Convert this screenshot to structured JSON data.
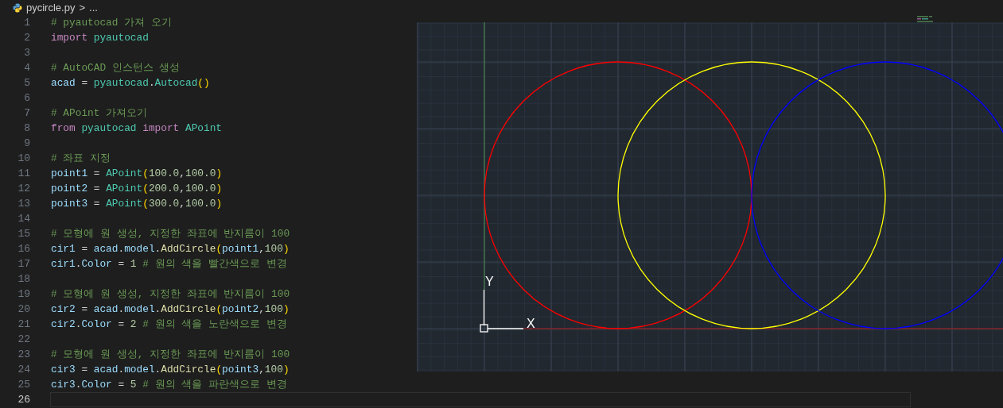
{
  "breadcrumb": {
    "file": "pycircle.py",
    "separator": ">",
    "rest": "..."
  },
  "lines": [
    {
      "number": "1",
      "current": false,
      "tokens": [
        {
          "t": "# pyautocad 가져 오기",
          "kind": "comment"
        }
      ]
    },
    {
      "number": "2",
      "current": false,
      "tokens": [
        {
          "t": "import ",
          "kind": "keyword"
        },
        {
          "t": "pyautocad",
          "kind": "class"
        }
      ]
    },
    {
      "number": "3",
      "current": false
    },
    {
      "number": "4",
      "current": false,
      "tokens": [
        {
          "t": "# AutoCAD 인스턴스 생성",
          "kind": "comment"
        }
      ]
    },
    {
      "number": "5",
      "current": false,
      "tokens": [
        {
          "t": "acad",
          "kind": "var"
        },
        {
          "t": " = ",
          "kind": "op"
        },
        {
          "t": "pyautocad",
          "kind": "class"
        },
        {
          "t": ".",
          "kind": "op"
        },
        {
          "t": "Autocad",
          "kind": "class"
        },
        {
          "t": "()",
          "kind": "paren"
        }
      ]
    },
    {
      "number": "6",
      "current": false
    },
    {
      "number": "7",
      "current": false,
      "tokens": [
        {
          "t": "# APoint 가져오기",
          "kind": "comment"
        }
      ]
    },
    {
      "number": "8",
      "current": false,
      "tokens": [
        {
          "t": "from ",
          "kind": "keyword"
        },
        {
          "t": "pyautocad ",
          "kind": "class"
        },
        {
          "t": "import ",
          "kind": "keyword"
        },
        {
          "t": "APoint",
          "kind": "class"
        }
      ]
    },
    {
      "number": "9",
      "current": false
    },
    {
      "number": "10",
      "current": false,
      "tokens": [
        {
          "t": "# 좌표 지정",
          "kind": "comment"
        }
      ]
    },
    {
      "number": "11",
      "current": false,
      "tokens": [
        {
          "t": "point1",
          "kind": "var"
        },
        {
          "t": " = ",
          "kind": "op"
        },
        {
          "t": "APoint",
          "kind": "class"
        },
        {
          "t": "(",
          "kind": "paren"
        },
        {
          "t": "100.0",
          "kind": "num"
        },
        {
          "t": ",",
          "kind": "op"
        },
        {
          "t": "100.0",
          "kind": "num"
        },
        {
          "t": ")",
          "kind": "paren"
        }
      ]
    },
    {
      "number": "12",
      "current": false,
      "tokens": [
        {
          "t": "point2",
          "kind": "var"
        },
        {
          "t": " = ",
          "kind": "op"
        },
        {
          "t": "APoint",
          "kind": "class"
        },
        {
          "t": "(",
          "kind": "paren"
        },
        {
          "t": "200.0",
          "kind": "num"
        },
        {
          "t": ",",
          "kind": "op"
        },
        {
          "t": "100.0",
          "kind": "num"
        },
        {
          "t": ")",
          "kind": "paren"
        }
      ]
    },
    {
      "number": "13",
      "current": false,
      "tokens": [
        {
          "t": "point3",
          "kind": "var"
        },
        {
          "t": " = ",
          "kind": "op"
        },
        {
          "t": "APoint",
          "kind": "class"
        },
        {
          "t": "(",
          "kind": "paren"
        },
        {
          "t": "300.0",
          "kind": "num"
        },
        {
          "t": ",",
          "kind": "op"
        },
        {
          "t": "100.0",
          "kind": "num"
        },
        {
          "t": ")",
          "kind": "paren"
        }
      ]
    },
    {
      "number": "14",
      "current": false
    },
    {
      "number": "15",
      "current": false,
      "tokens": [
        {
          "t": "# 모형에 원 생성, 지정한 좌표에 반지름이 100",
          "kind": "comment"
        }
      ]
    },
    {
      "number": "16",
      "current": false,
      "tokens": [
        {
          "t": "cir1",
          "kind": "var"
        },
        {
          "t": " = ",
          "kind": "op"
        },
        {
          "t": "acad",
          "kind": "var"
        },
        {
          "t": ".",
          "kind": "op"
        },
        {
          "t": "model",
          "kind": "var"
        },
        {
          "t": ".",
          "kind": "op"
        },
        {
          "t": "AddCircle",
          "kind": "func"
        },
        {
          "t": "(",
          "kind": "paren"
        },
        {
          "t": "point1",
          "kind": "var"
        },
        {
          "t": ",",
          "kind": "op"
        },
        {
          "t": "100",
          "kind": "num"
        },
        {
          "t": ")",
          "kind": "paren"
        }
      ]
    },
    {
      "number": "17",
      "current": false,
      "tokens": [
        {
          "t": "cir1",
          "kind": "var"
        },
        {
          "t": ".",
          "kind": "op"
        },
        {
          "t": "Color",
          "kind": "var"
        },
        {
          "t": " = ",
          "kind": "op"
        },
        {
          "t": "1",
          "kind": "num"
        },
        {
          "t": " # 원의 색을 빨간색으로 변경",
          "kind": "comment"
        }
      ]
    },
    {
      "number": "18",
      "current": false
    },
    {
      "number": "19",
      "current": false,
      "tokens": [
        {
          "t": "# 모형에 원 생성, 지정한 좌표에 반지름이 100",
          "kind": "comment"
        }
      ]
    },
    {
      "number": "20",
      "current": false,
      "tokens": [
        {
          "t": "cir2",
          "kind": "var"
        },
        {
          "t": " = ",
          "kind": "op"
        },
        {
          "t": "acad",
          "kind": "var"
        },
        {
          "t": ".",
          "kind": "op"
        },
        {
          "t": "model",
          "kind": "var"
        },
        {
          "t": ".",
          "kind": "op"
        },
        {
          "t": "AddCircle",
          "kind": "func"
        },
        {
          "t": "(",
          "kind": "paren"
        },
        {
          "t": "point2",
          "kind": "var"
        },
        {
          "t": ",",
          "kind": "op"
        },
        {
          "t": "100",
          "kind": "num"
        },
        {
          "t": ")",
          "kind": "paren"
        }
      ]
    },
    {
      "number": "21",
      "current": false,
      "tokens": [
        {
          "t": "cir2",
          "kind": "var"
        },
        {
          "t": ".",
          "kind": "op"
        },
        {
          "t": "Color",
          "kind": "var"
        },
        {
          "t": " = ",
          "kind": "op"
        },
        {
          "t": "2",
          "kind": "num"
        },
        {
          "t": " # 원의 색을 노란색으로 변경",
          "kind": "comment"
        }
      ]
    },
    {
      "number": "22",
      "current": false
    },
    {
      "number": "23",
      "current": false,
      "tokens": [
        {
          "t": "# 모형에 원 생성, 지정한 좌표에 반지름이 100",
          "kind": "comment"
        }
      ]
    },
    {
      "number": "24",
      "current": false,
      "tokens": [
        {
          "t": "cir3",
          "kind": "var"
        },
        {
          "t": " = ",
          "kind": "op"
        },
        {
          "t": "acad",
          "kind": "var"
        },
        {
          "t": ".",
          "kind": "op"
        },
        {
          "t": "model",
          "kind": "var"
        },
        {
          "t": ".",
          "kind": "op"
        },
        {
          "t": "AddCircle",
          "kind": "func"
        },
        {
          "t": "(",
          "kind": "paren"
        },
        {
          "t": "point3",
          "kind": "var"
        },
        {
          "t": ",",
          "kind": "op"
        },
        {
          "t": "100",
          "kind": "num"
        },
        {
          "t": ")",
          "kind": "paren"
        }
      ]
    },
    {
      "number": "25",
      "current": false,
      "tokens": [
        {
          "t": "cir3",
          "kind": "var"
        },
        {
          "t": ".",
          "kind": "op"
        },
        {
          "t": "Color",
          "kind": "var"
        },
        {
          "t": " = ",
          "kind": "op"
        },
        {
          "t": "5",
          "kind": "num"
        },
        {
          "t": " # 원의 색을 파란색으로 변경",
          "kind": "comment"
        }
      ]
    },
    {
      "number": "26",
      "current": true
    }
  ],
  "cad_view": {
    "circles": [
      {
        "color": "#ff0000"
      },
      {
        "color": "#ffff00"
      },
      {
        "color": "#0000ff"
      }
    ],
    "ucs": {
      "x_label": "X",
      "y_label": "Y"
    }
  }
}
